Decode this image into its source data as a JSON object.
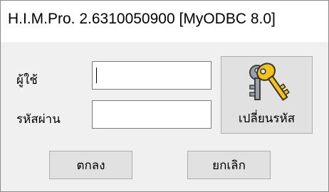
{
  "window": {
    "title": "H.I.M.Pro. 2.6310050900 [MyODBC 8.0]"
  },
  "form": {
    "user_label": "ผู้ใช้",
    "user_value": "",
    "password_label": "รหัสผ่าน",
    "password_value": ""
  },
  "buttons": {
    "change_password_label": "เปลี่ยนรหัส",
    "change_password_icon": "keys-icon",
    "ok_label": "ตกลง",
    "cancel_label": "ยกเลิก"
  },
  "colors": {
    "dialog_bg": "#f0f0f0",
    "button_bg": "#e1e1e1",
    "key_gold": "#f2c419",
    "key_gray": "#8c9499"
  }
}
